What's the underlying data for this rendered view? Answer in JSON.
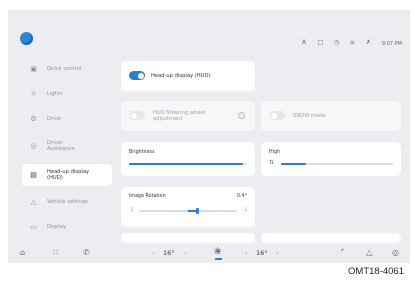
{
  "status_bar": {
    "icons": [
      "letter-a-icon",
      "square-icon",
      "clock-icon",
      "signal-icon",
      "bluetooth-icon"
    ],
    "time": "9:07 PM",
    "time_color": "#5d6677"
  },
  "sidebar": {
    "items": [
      {
        "label": "Quick control",
        "icon": "car-icon",
        "active": false
      },
      {
        "label": "Lights",
        "icon": "light-icon",
        "active": false
      },
      {
        "label": "Drive",
        "icon": "steering-icon",
        "active": false
      },
      {
        "label": "Driver\nAssistance",
        "icon": "assist-icon",
        "active": false
      },
      {
        "label": "Head-up display\n(HUD)",
        "icon": "hud-icon",
        "active": true
      },
      {
        "label": "Vehicle settings",
        "icon": "vehicle-icon",
        "active": false
      },
      {
        "label": "Display",
        "icon": "display-icon",
        "active": false
      }
    ]
  },
  "hud": {
    "label": "Head-up display (HUD)",
    "enabled": true
  },
  "steering_adjust": {
    "label": "HUD Steering wheel\nadjustment",
    "enabled": false
  },
  "snow_mode": {
    "label": "SNOW mode",
    "enabled": false
  },
  "brightness": {
    "label": "Brightness",
    "value_fraction": 0.97
  },
  "high": {
    "label": "High",
    "value_fraction": 0.22
  },
  "image_rotation": {
    "label": "Image Rotation",
    "value_label": "0.4°",
    "min_label": "-2",
    "max_label": "2",
    "value": 0.4
  },
  "bottom_bar": {
    "left_temp": "16",
    "right_temp": "16",
    "degree": "°"
  },
  "caption": "OMT18-4061",
  "colors": {
    "accent": "#2a7fd4",
    "background": "#ededf1",
    "card": "#ffffff"
  }
}
